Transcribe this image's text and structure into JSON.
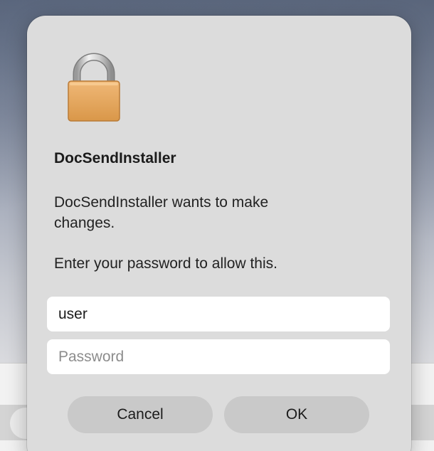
{
  "dialog": {
    "icon": "lock-icon",
    "title": "DocSendInstaller",
    "message": "DocSendInstaller wants to make changes.",
    "prompt": "Enter your password to allow this.",
    "username_value": "user",
    "password_placeholder": "Password",
    "cancel_label": "Cancel",
    "ok_label": "OK"
  },
  "colors": {
    "dialog_background": "#dcdcdc",
    "button_background": "#c9c9c9",
    "lock_body": "#e3a65e"
  }
}
